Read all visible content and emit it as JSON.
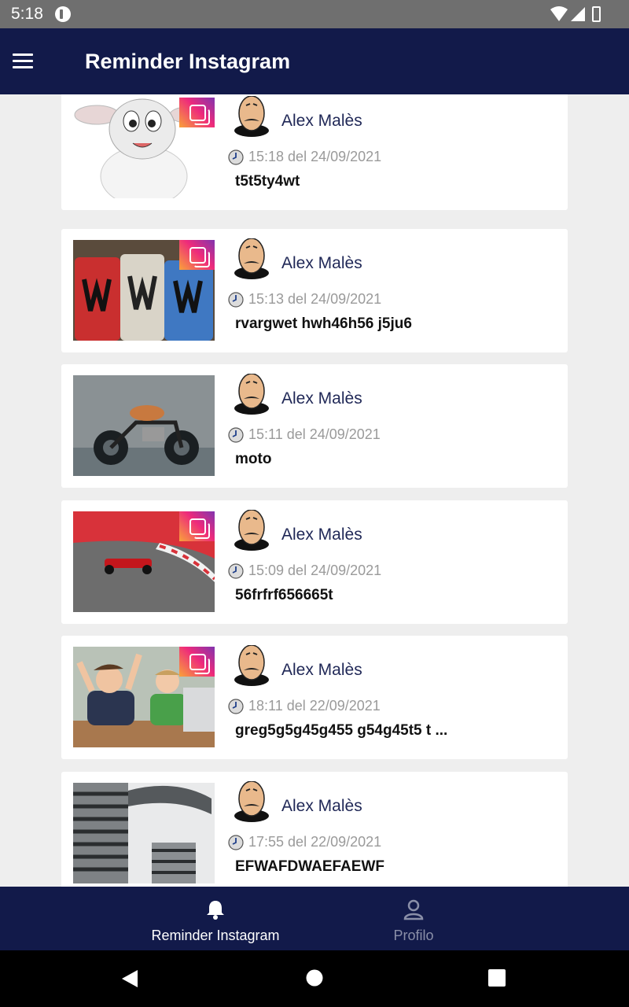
{
  "status_bar": {
    "time": "5:18"
  },
  "app_bar": {
    "title": "Reminder Instagram"
  },
  "posts": [
    {
      "author": "Alex Malès",
      "datetime": "15:18 del 24/09/2021",
      "caption": "t5t5ty4wt",
      "thumbnail": "sheep-cartoon",
      "instagram_badge": true
    },
    {
      "author": "Alex Malès",
      "datetime": "15:13 del 24/09/2021",
      "caption": "rvargwet hwh46h56 j5ju6",
      "thumbnail": "monster-cans",
      "instagram_badge": true
    },
    {
      "author": "Alex Malès",
      "datetime": "15:11 del 24/09/2021",
      "caption": "moto",
      "thumbnail": "motorcycle",
      "instagram_badge": false
    },
    {
      "author": "Alex Malès",
      "datetime": "15:09 del 24/09/2021",
      "caption": "56frfrf656665t",
      "thumbnail": "f1-car",
      "instagram_badge": true
    },
    {
      "author": "Alex Malès",
      "datetime": "18:11 del 22/09/2021",
      "caption": "greg5g5g45g455 g54g45t5 t ...",
      "thumbnail": "kids-laptop",
      "instagram_badge": true
    },
    {
      "author": "Alex Malès",
      "datetime": "17:55 del 22/09/2021",
      "caption": "EFWAFDWAEFAEWF",
      "thumbnail": "stadium",
      "instagram_badge": false
    }
  ],
  "bottom_nav": {
    "items": [
      {
        "label": "Reminder Instagram",
        "icon": "bell-icon",
        "active": true
      },
      {
        "label": "Profilo",
        "icon": "person-icon",
        "active": false
      }
    ]
  },
  "colors": {
    "primary": "#121a4a",
    "card_bg": "#ffffff",
    "list_bg": "#eeeeee",
    "datetime": "#9a9a9a"
  }
}
